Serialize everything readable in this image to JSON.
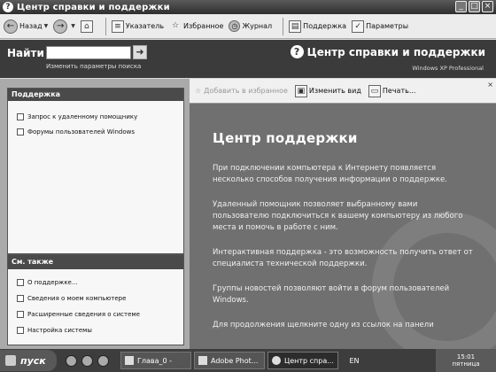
{
  "window": {
    "title": "Центр справки и поддержки"
  },
  "toolbar": {
    "back_label": "Назад",
    "index_label": "Указатель",
    "favorites_label": "Избранное",
    "history_label": "Журнал",
    "support_label": "Поддержка",
    "options_label": "Параметры"
  },
  "search": {
    "label": "Найти",
    "value": "",
    "options_link": "Изменить параметры поиска"
  },
  "header": {
    "logo_title": "Центр справки и поддержки",
    "edition": "Windows XP Professional"
  },
  "sidebar": {
    "support": {
      "title": "Поддержка",
      "items": [
        "Запрос к удаленному помощнику",
        "Форумы пользователей Windows"
      ]
    },
    "see_also": {
      "title": "См. также",
      "items": [
        "О поддержке...",
        "Сведения о моем компьютере",
        "Расширенные сведения о системе",
        "Настройка системы"
      ]
    }
  },
  "content_toolbar": {
    "add_favorites": "Добавить в избранное",
    "change_view": "Изменить вид",
    "print": "Печать..."
  },
  "content": {
    "title": "Центр поддержки",
    "paragraphs": [
      "При подключении компьютера к Интернету появляется несколько способов получения информации о поддержке.",
      "Удаленный помощник позволяет выбранному вами пользователю подключиться к вашему компьютеру из любого места и помочь в работе с ним.",
      "Интерактивная поддержка - это возможность получить ответ от специалиста технической поддержки.",
      "Группы новостей позволяют войти в форум пользователей Windows.",
      "Для продолжения щелкните одну из ссылок на панели"
    ]
  },
  "taskbar": {
    "start_label": "пуск",
    "tasks": [
      "Глава_0 -",
      "Adobe Phot...",
      "Центр спра..."
    ],
    "lang": "EN",
    "time": "15:01",
    "day": "пятница"
  }
}
